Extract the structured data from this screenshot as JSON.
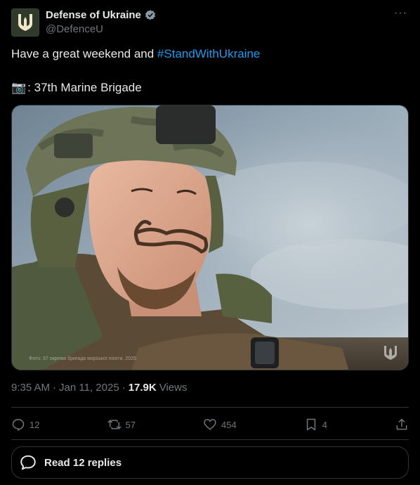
{
  "account": {
    "name": "Defense of Ukraine",
    "handle": "@DefenceU",
    "verified": true
  },
  "post": {
    "text": "Have a great weekend and ",
    "hashtag": "#StandWithUkraine",
    "camera_emoji": "📷",
    "caption": ": 37th Marine Brigade",
    "photo_credit": "Фото: 37 окрема бригада морської піхоти, 2025"
  },
  "meta": {
    "time": "9:35 AM",
    "separator1": "·",
    "date": "Jan 11, 2025",
    "separator2": "·",
    "views_count": "17.9K",
    "views_label": "Views"
  },
  "actions": {
    "reply_count": "12",
    "repost_count": "57",
    "like_count": "454",
    "bookmark_count": "4"
  },
  "replies_button": {
    "label": "Read 12 replies"
  },
  "colors": {
    "accent": "#1d9bf0",
    "secondary_text": "#71767b",
    "border": "#2f3336"
  },
  "icons": [
    "trident-icon",
    "verified-badge-icon",
    "more-icon",
    "camera-icon",
    "reply-icon",
    "repost-icon",
    "like-icon",
    "bookmark-icon",
    "share-icon",
    "chat-icon"
  ]
}
